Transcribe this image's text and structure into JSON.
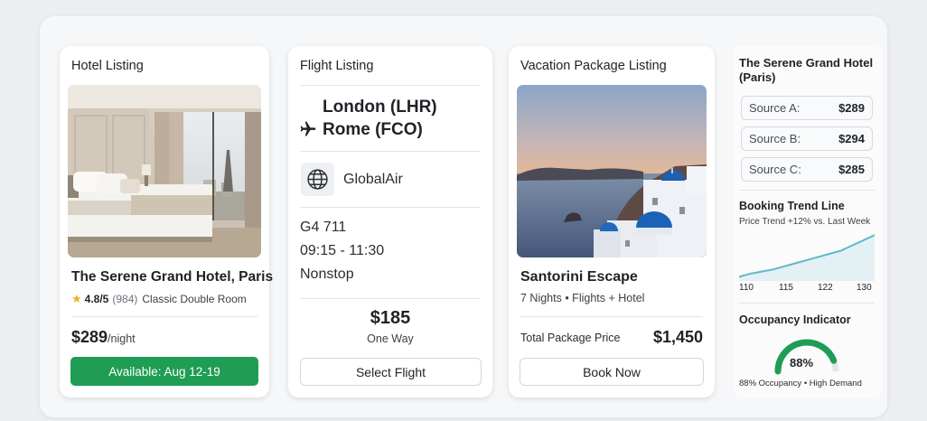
{
  "hotel": {
    "header": "Hotel Listing",
    "name": "The Serene Grand Hotel, Paris",
    "rating": "4.8/5",
    "reviews": "(984)",
    "room": "Classic Double Room",
    "price": "$289",
    "price_unit": "/night",
    "availability": "Available: Aug 12-19"
  },
  "flight": {
    "header": "Flight Listing",
    "route_from": "London (LHR)",
    "route_to": "Rome (FCO)",
    "airline": "GlobalAir",
    "flight_no": "G4 711",
    "times": "09:15 - 11:30",
    "stops": "Nonstop",
    "price": "$185",
    "trip_type": "One Way",
    "cta": "Select Flight"
  },
  "package": {
    "header": "Vacation Package Listing",
    "name": "Santorini Escape",
    "details": "7 Nights • Flights + Hotel",
    "total_label": "Total Package Price",
    "total_price": "$1,450",
    "cta": "Book Now"
  },
  "side": {
    "title": "The Serene Grand Hotel (Paris)",
    "sources": [
      {
        "label": "Source A:",
        "value": "$289"
      },
      {
        "label": "Source B:",
        "value": "$294"
      },
      {
        "label": "Source C:",
        "value": "$285"
      }
    ],
    "trend_title": "Booking Trend Line",
    "trend_sub": "Price Trend +12% vs. Last Week",
    "trend_ticks": [
      "110",
      "115",
      "122",
      "130"
    ],
    "trend_values": [
      110,
      111.5,
      112.5,
      113.5,
      115,
      116.5,
      118,
      119.5,
      121,
      122.5,
      125,
      127.5,
      130
    ],
    "occupancy_title": "Occupancy Indicator",
    "occupancy_value": 88,
    "occupancy_label": "88%",
    "occupancy_caption": "88% Occupancy • High Demand"
  },
  "colors": {
    "accent_green": "#1f9d55",
    "trend_line": "#5fb8c6",
    "gauge_track": "#e3e6ea",
    "star": "#f2b01e"
  }
}
